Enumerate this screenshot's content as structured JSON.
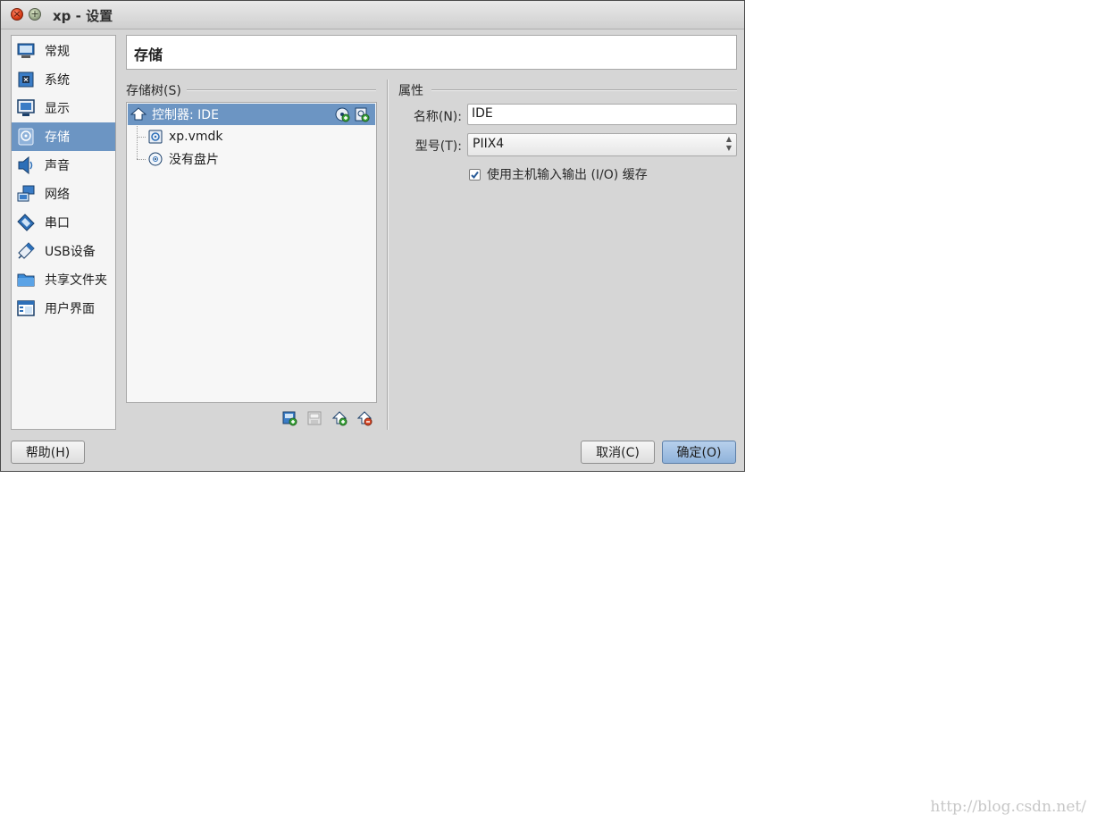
{
  "window": {
    "title": "xp - 设置"
  },
  "sidebar": {
    "items": [
      {
        "label": "常规",
        "icon": "monitor-icon"
      },
      {
        "label": "系统",
        "icon": "chip-icon"
      },
      {
        "label": "显示",
        "icon": "display-icon"
      },
      {
        "label": "存储",
        "icon": "storage-icon",
        "active": true
      },
      {
        "label": "声音",
        "icon": "speaker-icon"
      },
      {
        "label": "网络",
        "icon": "network-icon"
      },
      {
        "label": "串口",
        "icon": "serial-port-icon"
      },
      {
        "label": "USB设备",
        "icon": "usb-icon"
      },
      {
        "label": "共享文件夹",
        "icon": "folder-icon"
      },
      {
        "label": "用户界面",
        "icon": "ui-window-icon"
      }
    ]
  },
  "header": {
    "title": "存储"
  },
  "storage_tree": {
    "label": "存储树(S)",
    "controller": {
      "label": "控制器: IDE"
    },
    "children": [
      {
        "label": "xp.vmdk",
        "icon": "hard-disk-icon"
      },
      {
        "label": "没有盘片",
        "icon": "optical-disc-icon"
      }
    ]
  },
  "attributes": {
    "section_label": "属性",
    "name_label": "名称(N):",
    "name_value": "IDE",
    "type_label": "型号(T):",
    "type_value": "PIIX4",
    "host_io_cache_label": "使用主机输入输出 (I/O) 缓存",
    "host_io_cache_checked": true
  },
  "buttons": {
    "help": "帮助(H)",
    "cancel": "取消(C)",
    "ok": "确定(O)"
  },
  "watermark": "http://blog.csdn.net/"
}
